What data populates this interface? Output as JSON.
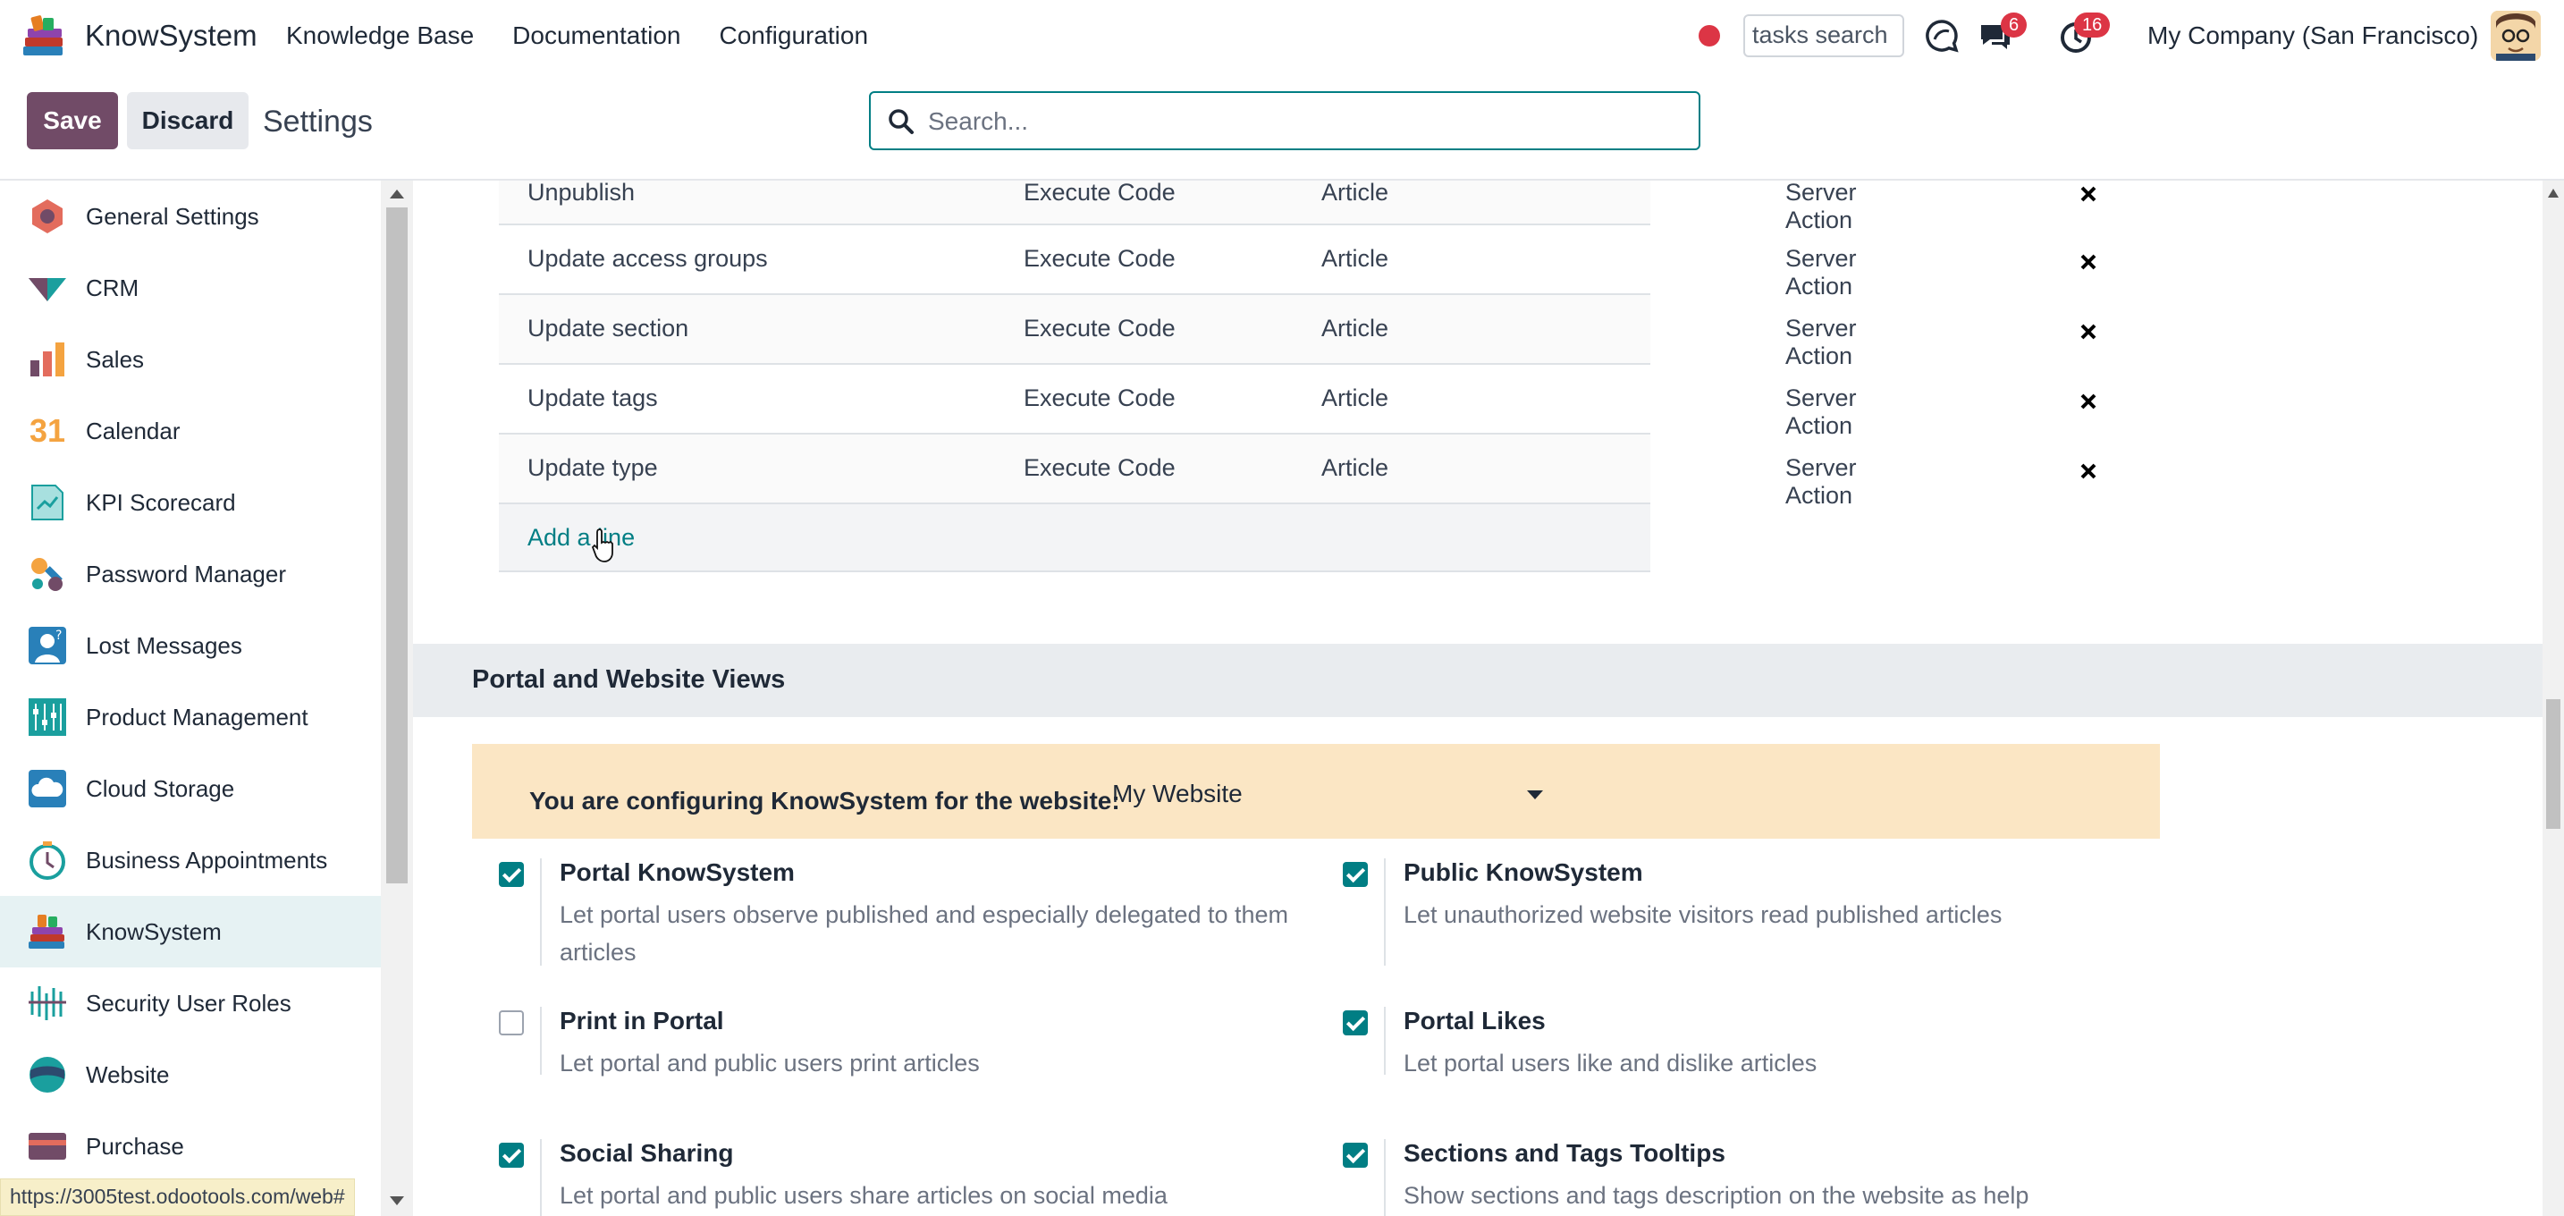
{
  "navbar": {
    "app_name": "KnowSystem",
    "menu": [
      "Knowledge Base",
      "Documentation",
      "Configuration"
    ],
    "task_search_placeholder": "tasks search",
    "messages_badge": "6",
    "activities_badge": "16",
    "company": "My Company (San Francisco)"
  },
  "control": {
    "save_label": "Save",
    "discard_label": "Discard",
    "title": "Settings",
    "search_placeholder": "Search..."
  },
  "sidebar": {
    "items": [
      {
        "label": "General Settings",
        "icon": "general-settings-icon"
      },
      {
        "label": "CRM",
        "icon": "crm-icon"
      },
      {
        "label": "Sales",
        "icon": "sales-icon"
      },
      {
        "label": "Calendar",
        "icon": "calendar-icon",
        "icon_text": "31"
      },
      {
        "label": "KPI Scorecard",
        "icon": "kpi-scorecard-icon"
      },
      {
        "label": "Password Manager",
        "icon": "password-manager-icon"
      },
      {
        "label": "Lost Messages",
        "icon": "lost-messages-icon"
      },
      {
        "label": "Product Management",
        "icon": "product-management-icon"
      },
      {
        "label": "Cloud Storage",
        "icon": "cloud-storage-icon"
      },
      {
        "label": "Business Appointments",
        "icon": "business-appointments-icon"
      },
      {
        "label": "KnowSystem",
        "icon": "knowsystem-icon",
        "active": true
      },
      {
        "label": "Security User Roles",
        "icon": "security-user-roles-icon"
      },
      {
        "label": "Website",
        "icon": "website-icon"
      },
      {
        "label": "Purchase",
        "icon": "purchase-icon"
      }
    ]
  },
  "status_url": "https://3005test.odootools.com/web#",
  "actions_table": {
    "rows": [
      {
        "name": "Unpublish",
        "type": "Execute Code",
        "model": "Article",
        "usage": "Server Action"
      },
      {
        "name": "Update access groups",
        "type": "Execute Code",
        "model": "Article",
        "usage": "Server Action"
      },
      {
        "name": "Update section",
        "type": "Execute Code",
        "model": "Article",
        "usage": "Server Action"
      },
      {
        "name": "Update tags",
        "type": "Execute Code",
        "model": "Article",
        "usage": "Server Action"
      },
      {
        "name": "Update type",
        "type": "Execute Code",
        "model": "Article",
        "usage": "Server Action"
      }
    ],
    "add_line_label": "Add a line"
  },
  "portal_section": {
    "title": "Portal and Website Views",
    "website_label": "You are configuring KnowSystem for the website:",
    "website_value": "My Website",
    "settings": [
      {
        "title": "Portal KnowSystem",
        "desc": "Let portal users observe published and especially delegated to them articles",
        "checked": true
      },
      {
        "title": "Public KnowSystem",
        "desc": "Let unauthorized website visitors read published articles",
        "checked": true
      },
      {
        "title": "Print in Portal",
        "desc": "Let portal and public users print articles",
        "checked": false
      },
      {
        "title": "Portal Likes",
        "desc": "Let portal users like and dislike articles",
        "checked": true
      },
      {
        "title": "Social Sharing",
        "desc": "Let portal and public users share articles on social media",
        "checked": true
      },
      {
        "title": "Sections and Tags Tooltips",
        "desc": "Show sections and tags description on the website as help",
        "checked": true
      }
    ]
  },
  "colors": {
    "brand": "#714b67",
    "accent": "#017e84",
    "badge": "#dc3545",
    "banner": "#fbe6c4"
  }
}
